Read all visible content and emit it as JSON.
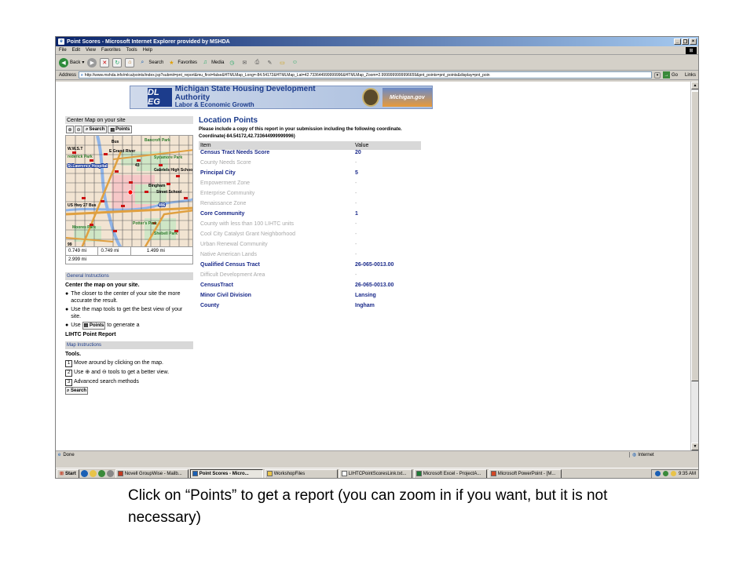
{
  "window": {
    "title": "Point Scores - Microsoft Internet Explorer provided by MSHDA",
    "controls": [
      "_",
      "❐",
      "×"
    ]
  },
  "menu": [
    "File",
    "Edit",
    "View",
    "Favorites",
    "Tools",
    "Help"
  ],
  "toolbar": {
    "back_label": "Back",
    "search_label": "Search",
    "favorites_label": "Favorites",
    "media_label": "Media"
  },
  "address": {
    "label": "Address",
    "url": "http://www.mshda.info/mlca/points/index.jsp?submit=pnt_report&mu_first=false&HTMLMap_Long=-84.54172&HTMLMap_Lat=42.733644999999996&HTMLMap_Zoom=2.9999999999996659&pnt_points=pnt_points&display=pnt_poin",
    "go_label": "Go",
    "links_label": "Links"
  },
  "banner": {
    "logo": "DL EG",
    "title": "Michigan State Housing Development Authority",
    "subtitle": "Labor & Economic Growth",
    "michigan_logo": "Michigan.gov"
  },
  "left": {
    "center_map_header": "Center Map on your site",
    "search_btn": "Search",
    "points_btn": "Points",
    "scale": [
      "0.749 mi",
      "0.749 mi",
      "1.499 mi"
    ],
    "scale_total": "2.999 mi",
    "map_labels": {
      "bus": "Bus",
      "bancroft": "Bancroft Park",
      "ws": "W.W.S.T",
      "grand_river": "E Grand River",
      "frederick": "rederick Park",
      "sycamore": "Sycamore Park",
      "st_lawrence": "St.Lawrence Hospital",
      "gabriels": "Gabriels High Schoo",
      "bingham": "Bingham",
      "street_school": "Street School",
      "us27": "US Hwy 27 Bus",
      "i496": "496",
      "potters": "Potter's Park",
      "shebell": "Shebell Park",
      "hosmer": "Moores Park",
      "route43": "43",
      "route99": "99"
    },
    "general_header": "General Instructions",
    "center_title": "Center the map on your site.",
    "bullet1": "The closer to the center of your site the more accurate the result.",
    "bullet2": "Use the map tools to get the best view of your site.",
    "bullet3_pre": "Use",
    "bullet3_post": "to generate a",
    "bullet3_bold": "LIHTC Point Report",
    "map_instr_header": "Map Instructions",
    "tools_title": "Tools.",
    "tool1": "Move around by clicking on the map.",
    "tool2_pre": "Use",
    "tool2_mid": "and",
    "tool2_post": "tools to get a better view.",
    "tool3": "Advanced search methods",
    "tool_nums": [
      "1",
      "2",
      "3"
    ]
  },
  "main": {
    "title": "Location Points",
    "instruction": "Please include a copy of this report in your submission including the following coordinate.",
    "coordinate": "Coordinate(-84.54172,42.733644999999996)",
    "col_item": "Item",
    "col_value": "Value",
    "rows": [
      {
        "item": "Census Tract Needs Score",
        "value": "20",
        "active": true
      },
      {
        "item": "County Needs Score",
        "value": "-",
        "active": false
      },
      {
        "item": "Principal City",
        "value": "5",
        "active": true
      },
      {
        "item": "Empowerment Zone",
        "value": "-",
        "active": false
      },
      {
        "item": "Enterprise Community",
        "value": "-",
        "active": false
      },
      {
        "item": "Renaissance Zone",
        "value": "-",
        "active": false
      },
      {
        "item": "Core Community",
        "value": "1",
        "active": true
      },
      {
        "item": "County with less than 100 LIHTC units",
        "value": "-",
        "active": false
      },
      {
        "item": "Cool City Catalyst Grant Neighborhood",
        "value": "-",
        "active": false
      },
      {
        "item": "Urban Renewal Community",
        "value": "-",
        "active": false
      },
      {
        "item": "Native American Lands",
        "value": "-",
        "active": false
      },
      {
        "item": "Qualified Census Tract",
        "value": "26-065-0013.00",
        "active": true
      },
      {
        "item": "Difficult Development Area",
        "value": "-",
        "active": false
      },
      {
        "item": "CensusTract",
        "value": "26-065-0013.00",
        "active": true
      },
      {
        "item": "Minor Civil Division",
        "value": "Lansing",
        "active": true
      },
      {
        "item": "County",
        "value": "Ingham",
        "active": true
      }
    ]
  },
  "status": {
    "text": "Done",
    "zone": "Internet"
  },
  "taskbar": {
    "start": "Start",
    "tasks": [
      {
        "label": "Novell GroupWise - Mailb...",
        "active": false,
        "color": "#c23b22"
      },
      {
        "label": "Point Scores - Micro...",
        "active": true,
        "color": "#1a5fb4"
      },
      {
        "label": "WorkshopFiles",
        "active": false,
        "color": "#e8c34a"
      },
      {
        "label": "LIHTCPointScoresLink.txt...",
        "active": false,
        "color": "#ffffff"
      },
      {
        "label": "Microsoft Excel - ProjectA...",
        "active": false,
        "color": "#1e7b34"
      },
      {
        "label": "Microsoft PowerPoint - [M...",
        "active": false,
        "color": "#d24726"
      }
    ],
    "clock": "9:35 AM"
  },
  "caption": "Click on “Points” to get a report (you can zoom in if you want, but it is not necessary)"
}
